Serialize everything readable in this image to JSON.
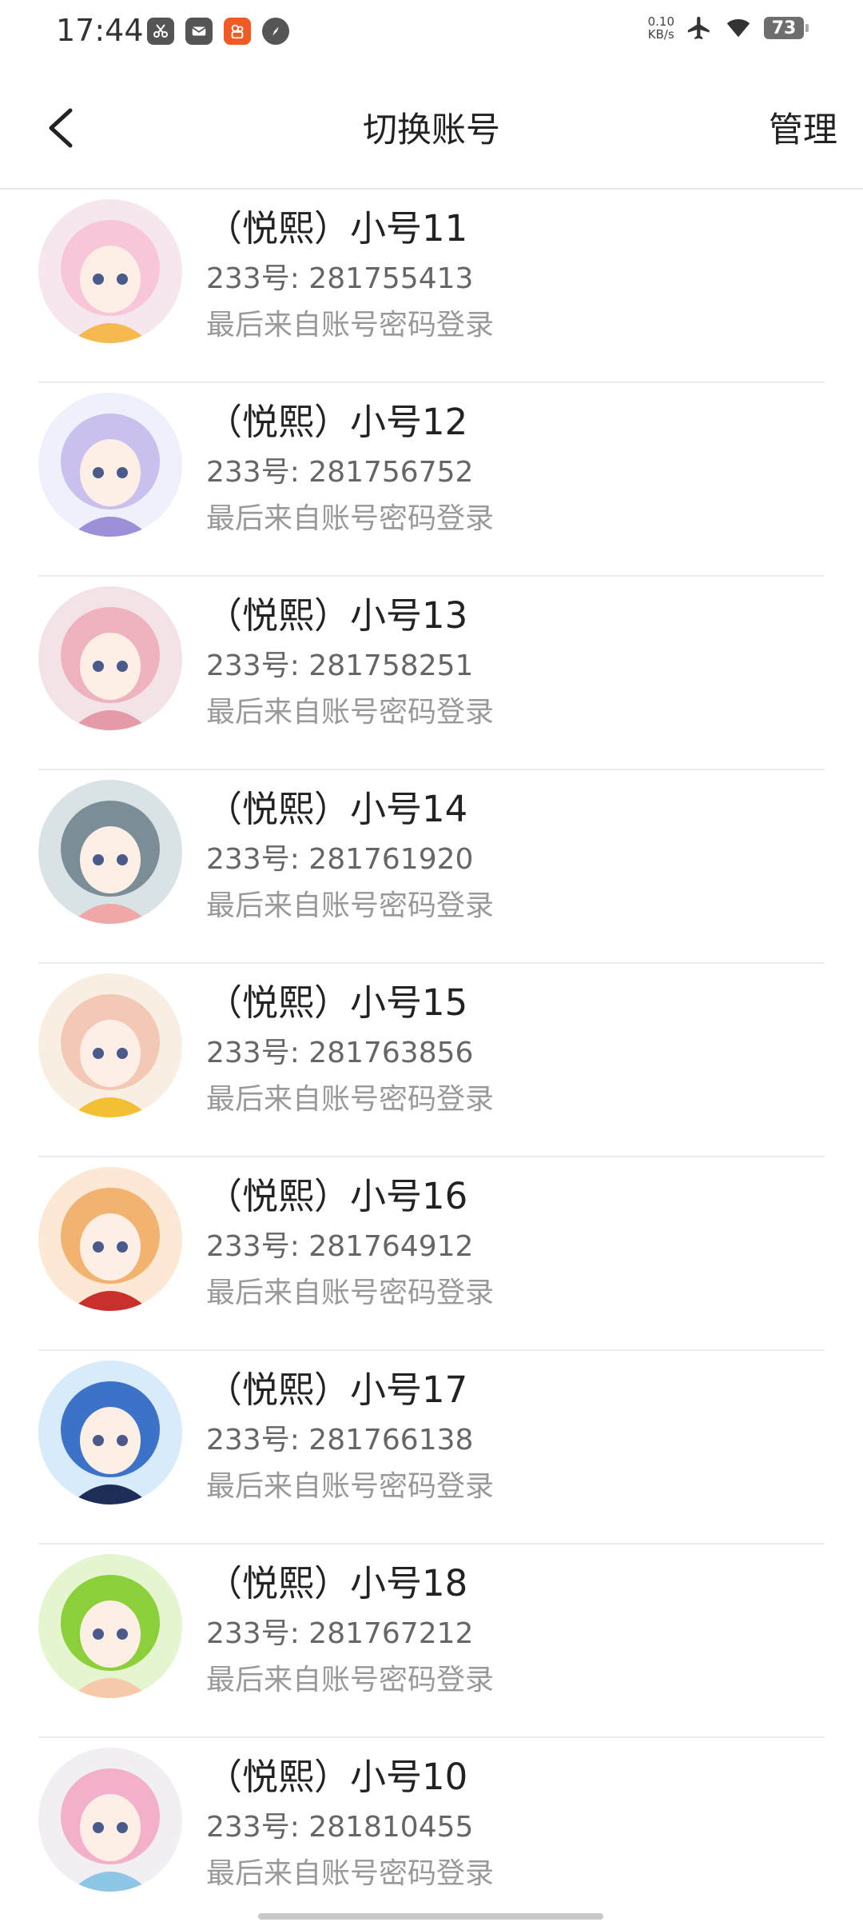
{
  "status_bar": {
    "time": "17:44",
    "net_speed_value": "0.10",
    "net_speed_unit": "KB/s",
    "battery": "73",
    "notif_icons": [
      "scissors-icon",
      "mail-icon",
      "app-icon",
      "compass-icon"
    ],
    "right_icons": [
      "airplane-icon",
      "wifi-icon"
    ]
  },
  "header": {
    "title": "切换账号",
    "manage_label": "管理"
  },
  "accounts": [
    {
      "name": "（悦熙）小号11",
      "uid": "233号: 281755413",
      "last_login": "最后来自账号密码登录",
      "avatar_colors": [
        "#f6e6ee",
        "#f7c6d8",
        "#f5b94f"
      ]
    },
    {
      "name": "（悦熙）小号12",
      "uid": "233号: 281756752",
      "last_login": "最后来自账号密码登录",
      "avatar_colors": [
        "#eef0fb",
        "#c9c0ee",
        "#9d8fd8"
      ]
    },
    {
      "name": "（悦熙）小号13",
      "uid": "233号: 281758251",
      "last_login": "最后来自账号密码登录",
      "avatar_colors": [
        "#f3e2e6",
        "#eeb3bf",
        "#e59aa8"
      ]
    },
    {
      "name": "（悦熙）小号14",
      "uid": "233号: 281761920",
      "last_login": "最后来自账号密码登录",
      "avatar_colors": [
        "#d9e3e6",
        "#7b8e98",
        "#f0a7a7"
      ]
    },
    {
      "name": "（悦熙）小号15",
      "uid": "233号: 281763856",
      "last_login": "最后来自账号密码登录",
      "avatar_colors": [
        "#f8efe2",
        "#f3c8b5",
        "#f2c032"
      ]
    },
    {
      "name": "（悦熙）小号16",
      "uid": "233号: 281764912",
      "last_login": "最后来自账号密码登录",
      "avatar_colors": [
        "#fce8d4",
        "#f1b36f",
        "#c9302c"
      ]
    },
    {
      "name": "（悦熙）小号17",
      "uid": "233号: 281766138",
      "last_login": "最后来自账号密码登录",
      "avatar_colors": [
        "#d7ebfa",
        "#3c73c9",
        "#1d2d58"
      ]
    },
    {
      "name": "（悦熙）小号18",
      "uid": "233号: 281767212",
      "last_login": "最后来自账号密码登录",
      "avatar_colors": [
        "#e4f5cf",
        "#8bd03a",
        "#f6c9a9"
      ]
    },
    {
      "name": "（悦熙）小号10",
      "uid": "233号: 281810455",
      "last_login": "最后来自账号密码登录",
      "avatar_colors": [
        "#f1eef4",
        "#f2b0ca",
        "#8ec6e6"
      ]
    }
  ]
}
